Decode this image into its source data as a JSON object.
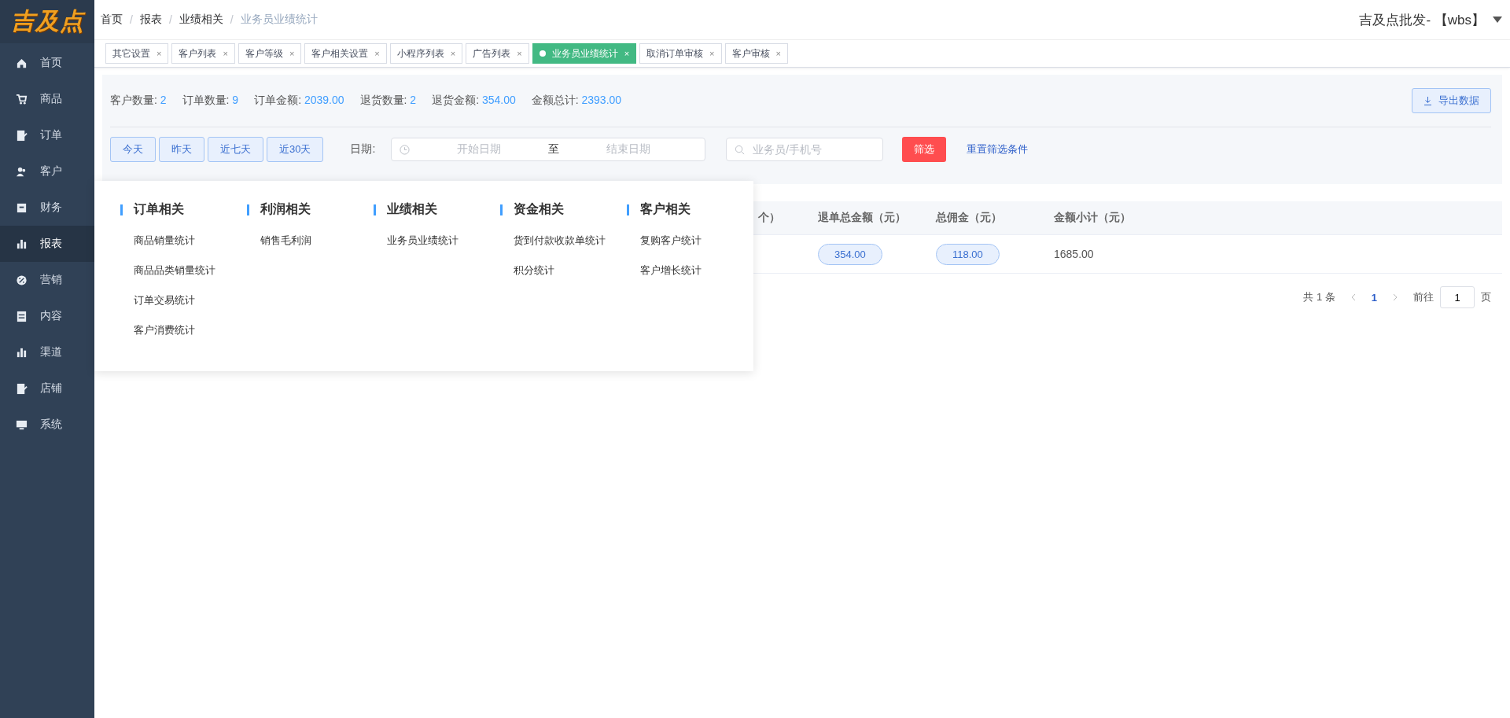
{
  "logo": {
    "text": "吉及点"
  },
  "sidebar": {
    "items": [
      {
        "label": "首页",
        "selected": false
      },
      {
        "label": "商品",
        "selected": false
      },
      {
        "label": "订单",
        "selected": false
      },
      {
        "label": "客户",
        "selected": false
      },
      {
        "label": "财务",
        "selected": false
      },
      {
        "label": "报表",
        "selected": true
      },
      {
        "label": "营销",
        "selected": false
      },
      {
        "label": "内容",
        "selected": false
      },
      {
        "label": "渠道",
        "selected": false
      },
      {
        "label": "店铺",
        "selected": false
      },
      {
        "label": "系统",
        "selected": false
      }
    ]
  },
  "breadcrumb": [
    {
      "label": "首页",
      "current": false
    },
    {
      "label": "报表",
      "current": false
    },
    {
      "label": "业绩相关",
      "current": false
    },
    {
      "label": "业务员业绩统计",
      "current": true
    }
  ],
  "breadcrumb_separator": "/",
  "user": {
    "name": "吉及点批发-  【wbs】"
  },
  "tabs": [
    {
      "label": "其它设置",
      "selected": false
    },
    {
      "label": "客户列表",
      "selected": false
    },
    {
      "label": "客户等级",
      "selected": false
    },
    {
      "label": "客户相关设置",
      "selected": false
    },
    {
      "label": "小程序列表",
      "selected": false
    },
    {
      "label": "广告列表",
      "selected": false
    },
    {
      "label": "业务员业绩统计",
      "selected": true
    },
    {
      "label": "取消订单审核",
      "selected": false
    },
    {
      "label": "客户审核",
      "selected": false
    }
  ],
  "tab_close": "×",
  "stats": [
    {
      "label": "客户数量:",
      "value": "2"
    },
    {
      "label": "订单数量:",
      "value": "9"
    },
    {
      "label": "订单金额:",
      "value": "2039.00"
    },
    {
      "label": "退货数量:",
      "value": "2"
    },
    {
      "label": "退货金额:",
      "value": "354.00"
    },
    {
      "label": "金额总计:",
      "value": "2393.00"
    }
  ],
  "export_button": "导出数据",
  "quick_buttons": [
    "今天",
    "昨天",
    "近七天",
    "近30天"
  ],
  "date": {
    "label": "日期:",
    "start_placeholder": "开始日期",
    "separator": "至",
    "end_placeholder": "结束日期"
  },
  "search": {
    "placeholder": "业务员/手机号"
  },
  "filter_button": "筛选",
  "reset_link": "重置筛选条件",
  "table": {
    "columns": [
      "个）",
      "退单总金额（元）",
      "总佣金（元）",
      "金额小计（元）"
    ],
    "rows": [
      {
        "cells": [
          {
            "kind": "empty"
          },
          {
            "kind": "pill",
            "text": "354.00"
          },
          {
            "kind": "pill",
            "text": "118.00"
          },
          {
            "kind": "plain",
            "text": "1685.00"
          }
        ]
      }
    ]
  },
  "pagination": {
    "total": "共 1 条",
    "pages": [
      {
        "label": "1",
        "selected": true
      }
    ],
    "goto": "前往",
    "goto_value": "1",
    "suffix": "页"
  },
  "report_menu": {
    "groups": [
      {
        "title": "订单相关",
        "items": [
          "商品销量统计",
          "商品品类销量统计",
          "订单交易统计",
          "客户消费统计"
        ]
      },
      {
        "title": "利润相关",
        "items": [
          "销售毛利润"
        ]
      },
      {
        "title": "业绩相关",
        "items": [
          "业务员业绩统计"
        ]
      },
      {
        "title": "资金相关",
        "items": [
          "货到付款收款单统计",
          "积分统计"
        ]
      },
      {
        "title": "客户相关",
        "items": [
          "复购客户统计",
          "客户增长统计"
        ]
      }
    ]
  }
}
